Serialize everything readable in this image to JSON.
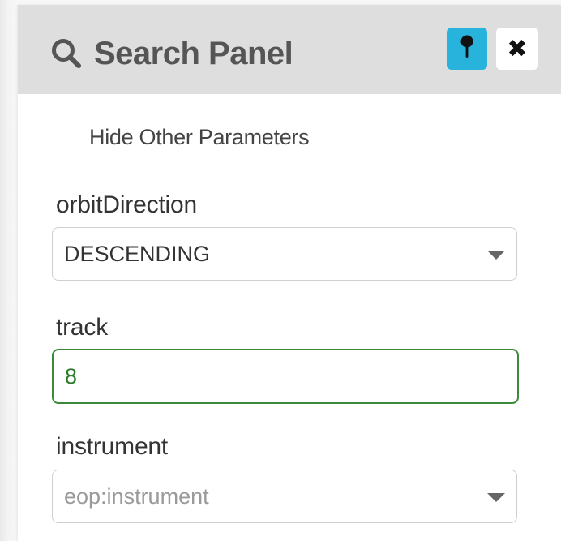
{
  "header": {
    "title": "Search Panel",
    "icons": {
      "search": "search-icon",
      "pin": "map-pin-icon",
      "close": "close-icon"
    },
    "close_label": "✖",
    "pin_color": "#27b3db"
  },
  "toggle_link": "Hide Other Parameters",
  "fields": {
    "orbitDirection": {
      "label": "orbitDirection",
      "value": "DESCENDING"
    },
    "track": {
      "label": "track",
      "value": "8",
      "border_color": "#3b8a3b"
    },
    "instrument": {
      "label": "instrument",
      "placeholder": "eop:instrument"
    }
  }
}
